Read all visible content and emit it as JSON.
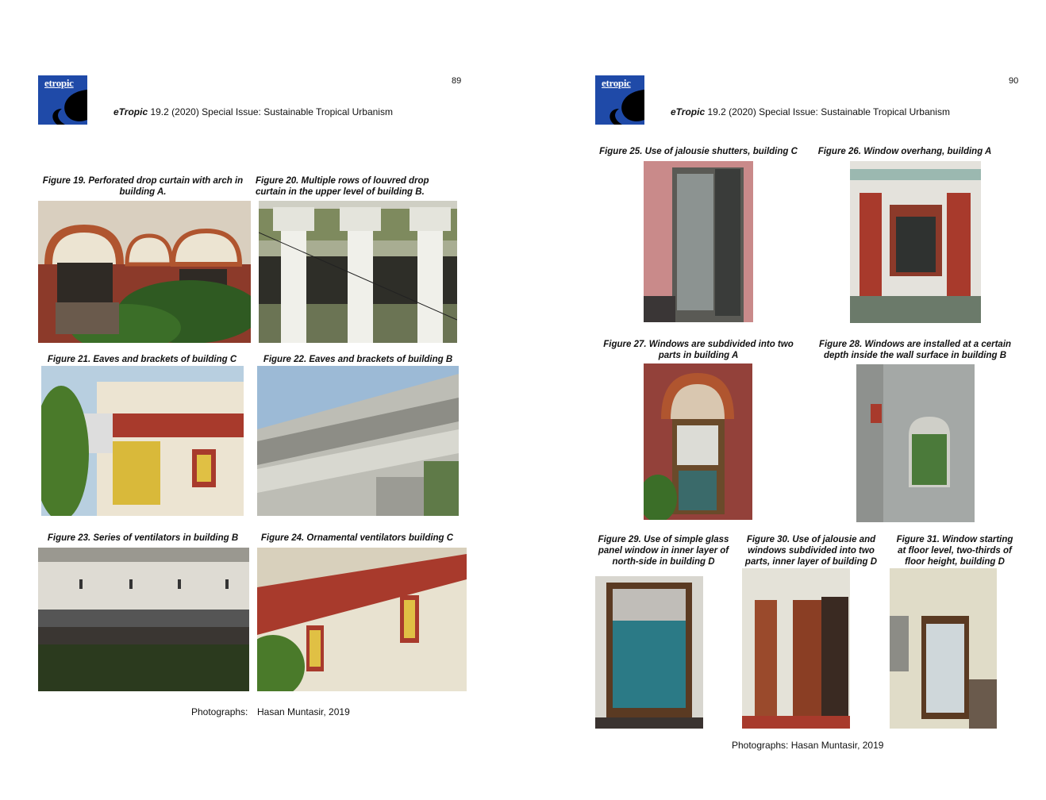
{
  "left_page": {
    "page_number": "89",
    "logo_text": "etropic",
    "journal_name": "eTropic",
    "journal_info": " 19.2 (2020) Special Issue: Sustainable Tropical Urbanism",
    "figures": {
      "f19": "Figure 19. Perforated drop curtain with arch in building A.",
      "f20": "Figure 20. Multiple rows of louvred drop curtain in the upper level of building B.",
      "f21": "Figure 21. Eaves and brackets of building C",
      "f22": "Figure 22. Eaves and brackets of building B",
      "f23": "Figure 23. Series of ventilators in building B",
      "f24": "Figure 24. Ornamental ventilators building C"
    },
    "credit_label": "Photographs:",
    "credit_name": "Hasan Muntasir, 2019"
  },
  "right_page": {
    "page_number": "90",
    "logo_text": "etropic",
    "journal_name": "eTropic",
    "journal_info": " 19.2 (2020) Special Issue: Sustainable Tropical Urbanism",
    "figures": {
      "f25": "Figure 25. Use of jalousie shutters, building C",
      "f26": "Figure 26. Window overhang, building A",
      "f27": "Figure 27. Windows are subdivided into two parts in building A",
      "f28": "Figure 28. Windows are installed at a certain depth inside the wall surface in building B",
      "f29": "Figure 29. Use of simple glass panel window in inner layer of north-side in building D",
      "f30": "Figure 30. Use of jalousie and windows subdivided into two parts, inner layer of building D",
      "f31": "Figure 31. Window starting at floor level, two-thirds of floor height, building D"
    },
    "credit": "Photographs: Hasan Muntasir, 2019"
  },
  "colors": {
    "logo_blue": "#1f4aa8",
    "brick_red": "#a83a2c",
    "cream": "#ece4d2"
  }
}
